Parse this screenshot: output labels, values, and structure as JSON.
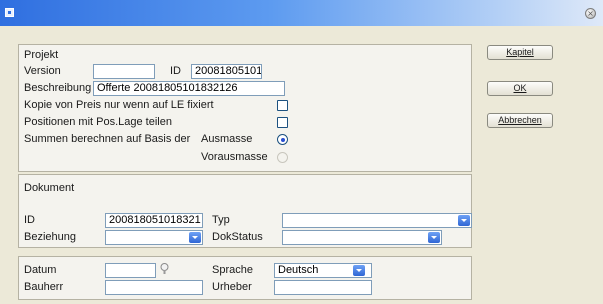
{
  "window": {
    "close_symbol": "×",
    "icon": "app-icon"
  },
  "projekt": {
    "section_title": "Projekt",
    "version_label": "Version",
    "version_value": "",
    "id_label": "ID",
    "id_value": "20081805101",
    "beschreibung_label": "Beschreibung",
    "beschreibung_value": "Offerte 20081805101832126",
    "kopie_label": "Kopie von Preis nur wenn auf LE fixiert",
    "kopie_checked": false,
    "positionen_label": "Positionen mit Pos.Lage teilen",
    "positionen_checked": false,
    "summen_label": "Summen berechnen auf Basis der",
    "ausmasse_label": "Ausmasse",
    "ausmasse_selected": true,
    "vorausmasse_label": "Vorausmasse",
    "vorausmasse_selected": false
  },
  "dokument": {
    "section_title": "Dokument",
    "id_label": "ID",
    "id_value": "200818051018321",
    "typ_label": "Typ",
    "typ_value": "",
    "beziehung_label": "Beziehung",
    "beziehung_value": "",
    "dokstatus_label": "DokStatus",
    "dokstatus_value": ""
  },
  "details": {
    "datum_label": "Datum",
    "datum_value": "",
    "sprache_label": "Sprache",
    "sprache_value": "Deutsch",
    "bauherr_label": "Bauherr",
    "bauherr_value": "",
    "urheber_label": "Urheber",
    "urheber_value": ""
  },
  "buttons": {
    "kapitel": "Kapitel",
    "ok": "OK",
    "abbrechen": "Abbrechen"
  },
  "colors": {
    "titlebar_start": "#2f6fe0",
    "titlebar_end": "#dfe9f8",
    "background": "#ece9d8",
    "field_border": "#7f9db9",
    "combo_button": "#2f66d4"
  }
}
